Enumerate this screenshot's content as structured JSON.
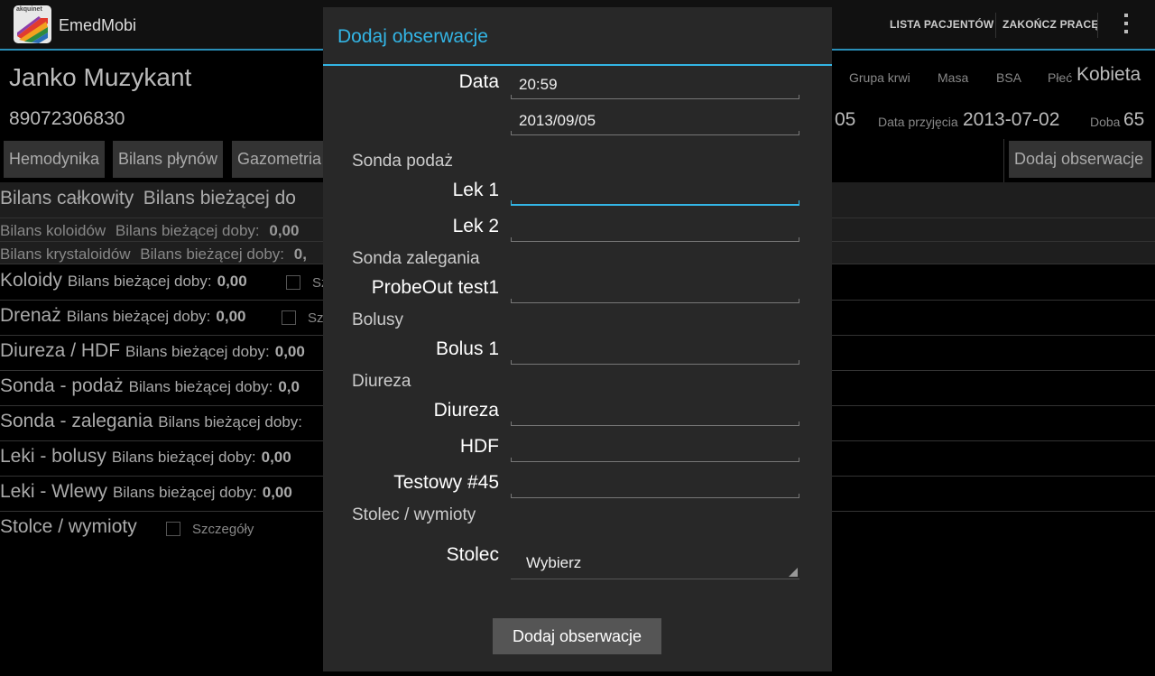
{
  "app": {
    "icon_text": "akquinet",
    "title": "EmedMobi",
    "actions": [
      "LISTA PACJENTÓW",
      "ZAKOŃCZ PRACĘ"
    ],
    "overflow_icon": "overflow-menu-icon"
  },
  "patient": {
    "name": "Janko Muzykant",
    "id": "89072306830",
    "blood_group_label": "Grupa krwi",
    "mass_label": "Masa",
    "bsa_label": "BSA",
    "sex_label": "Płeć",
    "sex_value": "Kobieta",
    "partial_value": "05",
    "admission_label": "Data przyjęcia",
    "admission_value": "2013-07-02",
    "day_label": "Doba",
    "day_value": "65"
  },
  "tabs": [
    "Hemodynika",
    "Bilans płynów",
    "Gazometria"
  ],
  "add_observation_tab": "Dodaj obserwacje",
  "background_list": {
    "header": {
      "title": "Bilans całkowity",
      "sub": "Bilans bieżącej do"
    },
    "sub_rows": [
      {
        "title": "Bilans koloidów",
        "sub": "Bilans bieżącej doby:",
        "value": "0,00"
      },
      {
        "title": "Bilans krystaloidów",
        "sub": "Bilans bieżącej doby:",
        "value": "0,"
      }
    ],
    "rows": [
      {
        "title": "Koloidy",
        "sub": "Bilans bieżącej doby:",
        "value": "0,00",
        "check": "Sz"
      },
      {
        "title": "Drenaż",
        "sub": "Bilans bieżącej doby:",
        "value": "0,00",
        "check": "Sz"
      },
      {
        "title": "Diureza / HDF",
        "sub": "Bilans bieżącej doby:",
        "value": "0,00"
      },
      {
        "title": "Sonda - podaż",
        "sub": "Bilans bieżącej doby:",
        "value": "0,0"
      },
      {
        "title": "Sonda - zalegania",
        "sub": "Bilans bieżącej doby:",
        "value": ""
      },
      {
        "title": "Leki - bolusy",
        "sub": "Bilans bieżącej doby:",
        "value": "0,00"
      },
      {
        "title": "Leki - Wlewy",
        "sub": "Bilans bieżącej doby:",
        "value": "0,00"
      },
      {
        "title": "Stolce / wymioty",
        "sub": "",
        "value": "",
        "check": "Szczegóły"
      }
    ]
  },
  "dialog": {
    "title": "Dodaj obserwacje",
    "date_label": "Data",
    "time_value": "20:59",
    "date_value": "2013/09/05",
    "section_sonda_podaz": "Sonda podaż",
    "lek1_label": "Lek 1",
    "lek2_label": "Lek 2",
    "section_sonda_zalegania": "Sonda zalegania",
    "probeout_label": "ProbeOut test1",
    "section_bolusy": "Bolusy",
    "bolus1_label": "Bolus 1",
    "section_diureza": "Diureza",
    "diureza_label": "Diureza",
    "hdf_label": "HDF",
    "testowy_label": "Testowy #45",
    "section_stolec": "Stolec / wymioty",
    "stolec_label": "Stolec",
    "stolec_value": "Wybierz",
    "submit_label": "Dodaj obserwacje"
  },
  "colors": {
    "accent": "#33b5e5",
    "background": "#000000",
    "dialog": "#282828"
  }
}
